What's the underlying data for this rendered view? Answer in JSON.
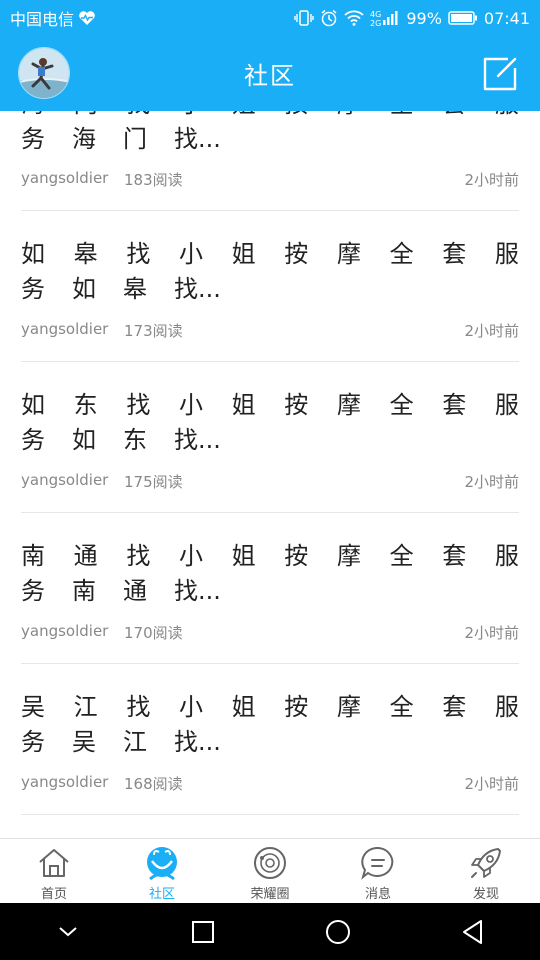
{
  "status_bar": {
    "carrier": "中国电信",
    "battery": "99%",
    "time": "07:41"
  },
  "header": {
    "title": "社区"
  },
  "posts": [
    {
      "title_line1": [
        "海",
        "门",
        "找",
        "小",
        "姐",
        "按",
        "摩",
        "全",
        "套",
        "服"
      ],
      "title_line2": [
        "务",
        "海",
        "门",
        "找..."
      ],
      "author": "yangsoldier",
      "reads": "183阅读",
      "time": "2小时前"
    },
    {
      "title_line1": [
        "如",
        "皋",
        "找",
        "小",
        "姐",
        "按",
        "摩",
        "全",
        "套",
        "服"
      ],
      "title_line2": [
        "务",
        "如",
        "皋",
        "找..."
      ],
      "author": "yangsoldier",
      "reads": "173阅读",
      "time": "2小时前"
    },
    {
      "title_line1": [
        "如",
        "东",
        "找",
        "小",
        "姐",
        "按",
        "摩",
        "全",
        "套",
        "服"
      ],
      "title_line2": [
        "务",
        "如",
        "东",
        "找..."
      ],
      "author": "yangsoldier",
      "reads": "175阅读",
      "time": "2小时前"
    },
    {
      "title_line1": [
        "南",
        "通",
        "找",
        "小",
        "姐",
        "按",
        "摩",
        "全",
        "套",
        "服"
      ],
      "title_line2": [
        "务",
        "南",
        "通",
        "找..."
      ],
      "author": "yangsoldier",
      "reads": "170阅读",
      "time": "2小时前"
    },
    {
      "title_line1": [
        "吴",
        "江",
        "找",
        "小",
        "姐",
        "按",
        "摩",
        "全",
        "套",
        "服"
      ],
      "title_line2": [
        "务",
        "吴",
        "江",
        "找..."
      ],
      "author": "yangsoldier",
      "reads": "168阅读",
      "time": "2小时前"
    }
  ],
  "tabs": [
    {
      "label": "首页",
      "icon": "home-icon"
    },
    {
      "label": "社区",
      "icon": "community-icon",
      "active": true
    },
    {
      "label": "荣耀圈",
      "icon": "honor-circle-icon"
    },
    {
      "label": "消息",
      "icon": "message-icon"
    },
    {
      "label": "发现",
      "icon": "rocket-icon"
    }
  ],
  "colors": {
    "accent": "#1aaef6",
    "text": "#222222",
    "meta": "#888888"
  }
}
